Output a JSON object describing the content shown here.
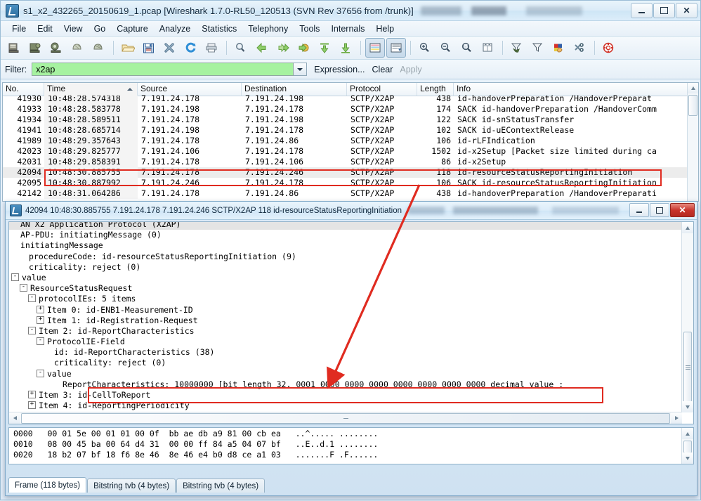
{
  "window": {
    "title": "s1_x2_432265_20150619_1.pcap  [Wireshark 1.7.0-RL50_120513  (SVN Rev 37656 from /trunk)]",
    "minimize_label": "Minimize",
    "maximize_label": "Maximize",
    "close_label": "✕"
  },
  "menu": [
    {
      "label": "File",
      "accel": "F"
    },
    {
      "label": "Edit",
      "accel": "E"
    },
    {
      "label": "View",
      "accel": "V"
    },
    {
      "label": "Go",
      "accel": "G"
    },
    {
      "label": "Capture",
      "accel": "C"
    },
    {
      "label": "Analyze",
      "accel": "A"
    },
    {
      "label": "Statistics",
      "accel": "S"
    },
    {
      "label": "Telephony",
      "accel": "T"
    },
    {
      "label": "Tools",
      "accel": "T"
    },
    {
      "label": "Internals",
      "accel": "I"
    },
    {
      "label": "Help",
      "accel": "H"
    }
  ],
  "toolbar": {
    "buttons": [
      "interfaces-icon",
      "capture-options-icon",
      "start-capture-icon",
      "stop-capture-icon",
      "restart-capture-icon",
      "open-file-icon",
      "save-file-icon",
      "close-file-icon",
      "reload-icon",
      "print-icon",
      "find-packet-icon",
      "go-back-icon",
      "go-forward-icon",
      "go-to-packet-icon",
      "go-first-packet-icon",
      "go-last-packet-icon",
      "colorize-icon",
      "auto-scroll-icon",
      "zoom-in-icon",
      "zoom-out-icon",
      "zoom-reset-icon",
      "resize-columns-icon",
      "capture-filters-icon",
      "display-filters-icon",
      "coloring-rules-icon",
      "preferences-icon",
      "help-icon"
    ]
  },
  "filter": {
    "label": "Filter:",
    "value": "x2ap",
    "placeholder": "",
    "expression_label": "Expression...",
    "clear_label": "Clear",
    "apply_label": "Apply"
  },
  "packet_list": {
    "columns": [
      "No.",
      "Time",
      "Source",
      "Destination",
      "Protocol",
      "Length",
      "Info"
    ],
    "sorted_column": "Time",
    "rows": [
      {
        "no": "41930",
        "time": "10:48:28.574318",
        "src": "7.191.24.178",
        "dst": "7.191.24.198",
        "proto": "SCTP/X2AP",
        "len": "438",
        "info": "id-handoverPreparation /HandoverPreparat",
        "selected": false
      },
      {
        "no": "41933",
        "time": "10:48:28.583778",
        "src": "7.191.24.198",
        "dst": "7.191.24.178",
        "proto": "SCTP/X2AP",
        "len": "174",
        "info": "SACK id-handoverPreparation /HandoverComm",
        "selected": false
      },
      {
        "no": "41934",
        "time": "10:48:28.589511",
        "src": "7.191.24.178",
        "dst": "7.191.24.198",
        "proto": "SCTP/X2AP",
        "len": "122",
        "info": "SACK id-snStatusTransfer",
        "selected": false
      },
      {
        "no": "41941",
        "time": "10:48:28.685714",
        "src": "7.191.24.198",
        "dst": "7.191.24.178",
        "proto": "SCTP/X2AP",
        "len": "102",
        "info": "SACK id-uEContextRelease",
        "selected": false
      },
      {
        "no": "41989",
        "time": "10:48:29.357643",
        "src": "7.191.24.178",
        "dst": "7.191.24.86",
        "proto": "SCTP/X2AP",
        "len": "106",
        "info": "id-rLFIndication",
        "selected": false
      },
      {
        "no": "42023",
        "time": "10:48:29.825777",
        "src": "7.191.24.106",
        "dst": "7.191.24.178",
        "proto": "SCTP/X2AP",
        "len": "1502",
        "info": "id-x2Setup [Packet size limited during ca",
        "selected": false
      },
      {
        "no": "42031",
        "time": "10:48:29.858391",
        "src": "7.191.24.178",
        "dst": "7.191.24.106",
        "proto": "SCTP/X2AP",
        "len": "86",
        "info": "id-x2Setup",
        "selected": false
      },
      {
        "no": "42094",
        "time": "10:48:30.885755",
        "src": "7.191.24.178",
        "dst": "7.191.24.246",
        "proto": "SCTP/X2AP",
        "len": "118",
        "info": "id-resourceStatusReportingInitiation",
        "selected": true
      },
      {
        "no": "42095",
        "time": "10:48:30.887992",
        "src": "7.191.24.246",
        "dst": "7.191.24.178",
        "proto": "SCTP/X2AP",
        "len": "106",
        "info": "SACK id-resourceStatusReportingInitiation",
        "selected": false
      },
      {
        "no": "42142",
        "time": "10:48:31.064286",
        "src": "7.191.24.178",
        "dst": "7.191.24.86",
        "proto": "SCTP/X2AP",
        "len": "438",
        "info": "id-handoverPreparation /HandoverPreparati",
        "selected": false
      }
    ]
  },
  "detail_window": {
    "title": "42094 10:48:30.885755 7.191.24.178 7.191.24.246 SCTP/X2AP 118 id-resourceStatusReportingInitiation",
    "close_label": "✕",
    "tree": [
      {
        "indent": 0,
        "toggle": "",
        "text": "AN X2 Application Protocol (X2AP)"
      },
      {
        "indent": 0,
        "toggle": "",
        "text": "AP-PDU: initiatingMessage (0)"
      },
      {
        "indent": 0,
        "toggle": "",
        "text": "initiatingMessage"
      },
      {
        "indent": 1,
        "toggle": "",
        "text": "procedureCode: id-resourceStatusReportingInitiation (9)"
      },
      {
        "indent": 1,
        "toggle": "",
        "text": "criticality: reject (0)"
      },
      {
        "indent": 0,
        "toggle": "-",
        "text": "value"
      },
      {
        "indent": 1,
        "toggle": "-",
        "text": "ResourceStatusRequest"
      },
      {
        "indent": 2,
        "toggle": "-",
        "text": "protocolIEs: 5 items"
      },
      {
        "indent": 3,
        "toggle": "+",
        "text": "Item 0: id-ENB1-Measurement-ID"
      },
      {
        "indent": 3,
        "toggle": "+",
        "text": "Item 1: id-Registration-Request"
      },
      {
        "indent": 2,
        "toggle": "-",
        "text": "Item 2: id-ReportCharacteristics"
      },
      {
        "indent": 3,
        "toggle": "-",
        "text": "ProtocolIE-Field"
      },
      {
        "indent": 4,
        "toggle": "",
        "text": "id: id-ReportCharacteristics (38)"
      },
      {
        "indent": 4,
        "toggle": "",
        "text": "criticality: reject (0)"
      },
      {
        "indent": 3,
        "toggle": "-",
        "text": "value"
      },
      {
        "indent": 5,
        "toggle": "",
        "text": "ReportCharacteristics: 10000000 [bit length 32, 0001 0000  0000 0000  0000 0000  0000 0000 decimal value :",
        "highlight": true
      },
      {
        "indent": 2,
        "toggle": "+",
        "text": "Item 3: id-CellToReport"
      },
      {
        "indent": 2,
        "toggle": "+",
        "text": "Item 4: id-ReportingPeriodicity"
      }
    ],
    "hex_rows": [
      {
        "offset": "0000",
        "bytes_left": "00 01 5e 00 01 01 00 0f",
        "bytes_right": "bb ae db a9 81 00 cb ea",
        "ascii": "..^..... ........"
      },
      {
        "offset": "0010",
        "bytes_left": "08 00 45 ba 00 64 d4 31",
        "bytes_right": "00 00 ff 84 a5 04 07 bf",
        "ascii": "..E..d.1 ........"
      },
      {
        "offset": "0020",
        "bytes_left": "18 b2 07 bf 18 f6 8e 46",
        "bytes_right": "8e 46 e4 b0 d8 ce a1 03",
        "ascii": ".......F .F......"
      }
    ],
    "tabs": [
      {
        "label": "Frame (118 bytes)",
        "active": true
      },
      {
        "label": "Bitstring tvb (4 bytes)",
        "active": false
      },
      {
        "label": "Bitstring tvb (4 bytes)",
        "active": false
      }
    ]
  },
  "annotations": {
    "accent_color": "#e02b20",
    "highlight_packet_row": "42094",
    "highlight_field": "ReportCharacteristics"
  }
}
